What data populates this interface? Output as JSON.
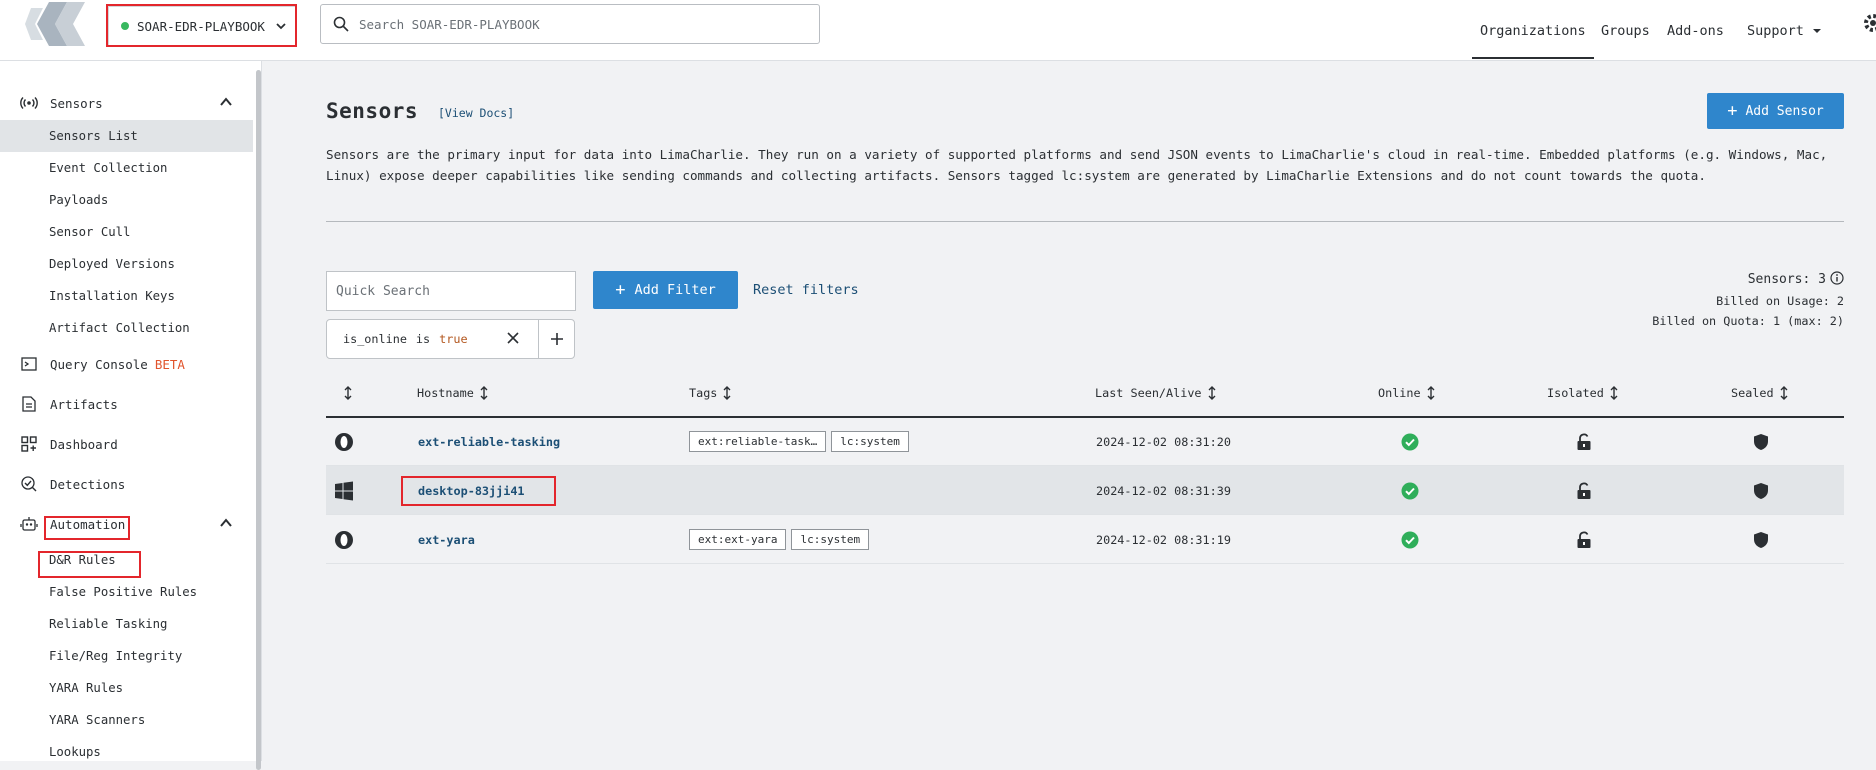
{
  "header": {
    "org_name": "SOAR-EDR-PLAYBOOK",
    "search_placeholder": "Search SOAR-EDR-PLAYBOOK",
    "nav": [
      "Organizations",
      "Groups",
      "Add-ons",
      "Support"
    ],
    "active_nav": "Organizations"
  },
  "sidebar": {
    "sensors_label": "Sensors",
    "sensors_sub": [
      "Sensors List",
      "Event Collection",
      "Payloads",
      "Sensor Cull",
      "Deployed Versions",
      "Installation Keys",
      "Artifact Collection"
    ],
    "query_console": "Query Console",
    "beta": "BETA",
    "artifacts": "Artifacts",
    "dashboard": "Dashboard",
    "detections": "Detections",
    "automation": "Automation",
    "automation_sub": [
      "D&R Rules",
      "False Positive Rules",
      "Reliable Tasking",
      "File/Reg Integrity",
      "YARA Rules",
      "YARA Scanners",
      "Lookups"
    ],
    "selected": "Sensors List"
  },
  "page": {
    "title": "Sensors",
    "view_docs": "[View Docs]",
    "add_sensor": "Add Sensor",
    "description": "Sensors are the primary input for data into LimaCharlie. They run on a variety of supported platforms and send JSON events to LimaCharlie's cloud in real-time. Embedded platforms (e.g. Windows, Mac, Linux) expose deeper capabilities like sending commands and collecting artifacts. Sensors tagged lc:system are generated by LimaCharlie Extensions and do not count towards the quota.",
    "quick_search_placeholder": "Quick Search",
    "add_filter": "Add Filter",
    "reset_filters": "Reset filters",
    "filter": {
      "field": "is_online",
      "op": "is",
      "value": "true"
    },
    "stats": {
      "sensors": "Sensors: 3",
      "billed_usage": "Billed on Usage: 2",
      "billed_quota": "Billed on Quota: 1 (max: 2)"
    }
  },
  "table": {
    "columns": [
      "Hostname",
      "Tags",
      "Last Seen/Alive",
      "Online",
      "Isolated",
      "Sealed"
    ],
    "rows": [
      {
        "platform": "extension-icon",
        "hostname": "ext-reliable-tasking",
        "tags": [
          "ext:reliable-task…",
          "lc:system"
        ],
        "last_seen": "2024-12-02 08:31:20",
        "online": true,
        "isolated": false,
        "sealed": true
      },
      {
        "platform": "windows-icon",
        "hostname": "desktop-83jji41",
        "tags": [],
        "last_seen": "2024-12-02 08:31:39",
        "online": true,
        "isolated": false,
        "sealed": true
      },
      {
        "platform": "extension-icon",
        "hostname": "ext-yara",
        "tags": [
          "ext:ext-yara",
          "lc:system"
        ],
        "last_seen": "2024-12-02 08:31:19",
        "online": true,
        "isolated": false,
        "sealed": true
      }
    ]
  },
  "colors": {
    "accent": "#2f86cc",
    "online": "#2fae5a",
    "link": "#1c4f75",
    "highlight": "#e3262c"
  }
}
